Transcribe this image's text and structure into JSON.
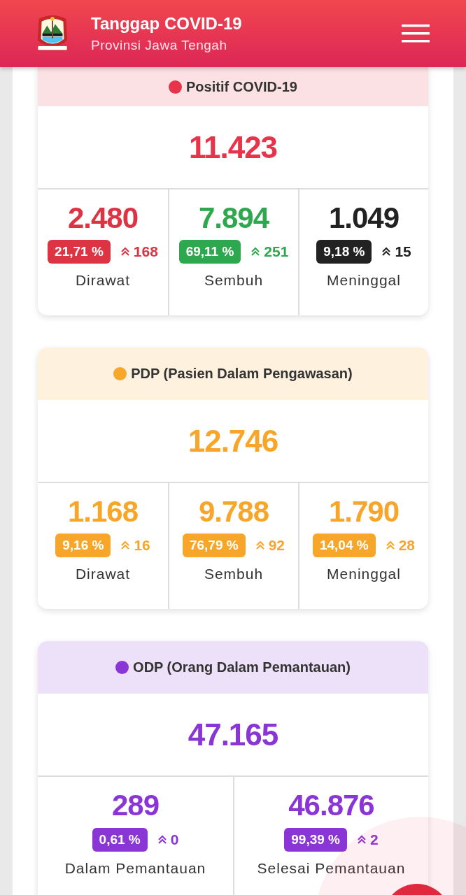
{
  "header": {
    "title": "Tanggap COVID-19",
    "subtitle": "Provinsi Jawa Tengah"
  },
  "sections": [
    {
      "title": "Positif COVID-19",
      "color": "#e8344b",
      "total": "11.423",
      "stats": [
        {
          "value": "2.480",
          "percent": "21,71 %",
          "increase": "168",
          "label": "Dirawat",
          "color": "#dd3444"
        },
        {
          "value": "7.894",
          "percent": "69,11 %",
          "increase": "251",
          "label": "Sembuh",
          "color": "#2ea84f"
        },
        {
          "value": "1.049",
          "percent": "9,18 %",
          "increase": "15",
          "label": "Meninggal",
          "color": "#222222"
        }
      ]
    },
    {
      "title": "PDP (Pasien Dalam Pengawasan)",
      "color": "#f8a62a",
      "total": "12.746",
      "stats": [
        {
          "value": "1.168",
          "percent": "9,16 %",
          "increase": "16",
          "label": "Dirawat",
          "color": "#f8a62a"
        },
        {
          "value": "9.788",
          "percent": "76,79 %",
          "increase": "92",
          "label": "Sembuh",
          "color": "#f8a62a"
        },
        {
          "value": "1.790",
          "percent": "14,04 %",
          "increase": "28",
          "label": "Meninggal",
          "color": "#f8a62a"
        }
      ]
    },
    {
      "title": "ODP (Orang Dalam Pemantauan)",
      "color": "#8a35d6",
      "total": "47.165",
      "stats": [
        {
          "value": "289",
          "percent": "0,61 %",
          "increase": "0",
          "label": "Dalam Pemantauan",
          "color": "#8a35d6"
        },
        {
          "value": "46.876",
          "percent": "99,39 %",
          "increase": "2",
          "label": "Selesai Pemantauan",
          "color": "#8a35d6"
        }
      ]
    }
  ]
}
